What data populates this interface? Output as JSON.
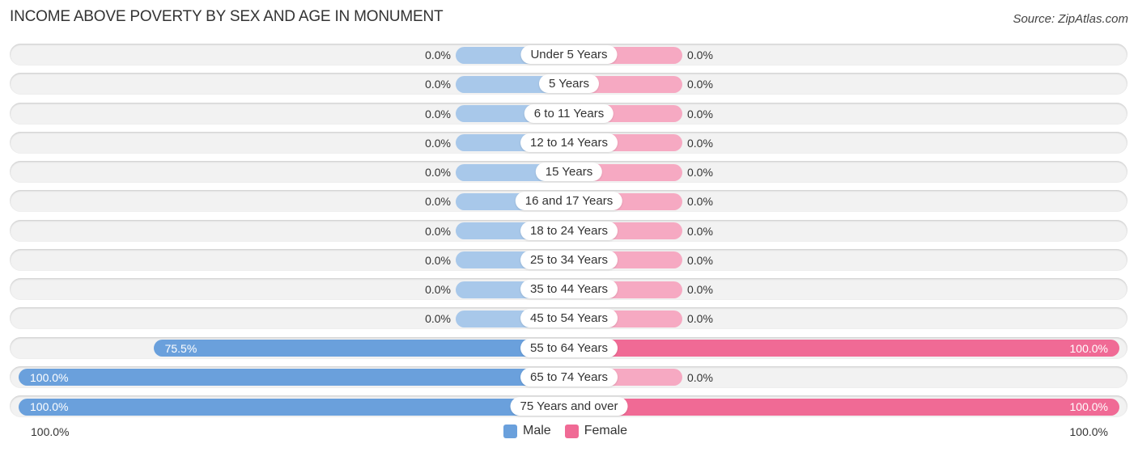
{
  "header": {
    "title": "INCOME ABOVE POVERTY BY SEX AND AGE IN MONUMENT",
    "source": "Source: ZipAtlas.com"
  },
  "colors": {
    "male": "#6aa0dc",
    "female": "#f06a95",
    "male_zero": "#a8c8ea",
    "female_zero": "#f6a9c2",
    "track": "#f2f2f2"
  },
  "chart_data": {
    "type": "bar",
    "orientation": "horizontal-diverging",
    "title": "INCOME ABOVE POVERTY BY SEX AND AGE IN MONUMENT",
    "categories": [
      "Under 5 Years",
      "5 Years",
      "6 to 11 Years",
      "12 to 14 Years",
      "15 Years",
      "16 and 17 Years",
      "18 to 24 Years",
      "25 to 34 Years",
      "35 to 44 Years",
      "45 to 54 Years",
      "55 to 64 Years",
      "65 to 74 Years",
      "75 Years and over"
    ],
    "series": [
      {
        "name": "Male",
        "values": [
          0.0,
          0.0,
          0.0,
          0.0,
          0.0,
          0.0,
          0.0,
          0.0,
          0.0,
          0.0,
          75.5,
          100.0,
          100.0
        ],
        "labels": [
          "0.0%",
          "0.0%",
          "0.0%",
          "0.0%",
          "0.0%",
          "0.0%",
          "0.0%",
          "0.0%",
          "0.0%",
          "0.0%",
          "75.5%",
          "100.0%",
          "100.0%"
        ]
      },
      {
        "name": "Female",
        "values": [
          0.0,
          0.0,
          0.0,
          0.0,
          0.0,
          0.0,
          0.0,
          0.0,
          0.0,
          0.0,
          100.0,
          0.0,
          100.0
        ],
        "labels": [
          "0.0%",
          "0.0%",
          "0.0%",
          "0.0%",
          "0.0%",
          "0.0%",
          "0.0%",
          "0.0%",
          "0.0%",
          "0.0%",
          "100.0%",
          "0.0%",
          "100.0%"
        ]
      }
    ],
    "xlim": [
      0,
      100
    ],
    "axis_labels": {
      "left": "100.0%",
      "right": "100.0%"
    },
    "legend": {
      "position": "bottom-center",
      "entries": [
        "Male",
        "Female"
      ]
    },
    "xlabel": "",
    "ylabel": ""
  }
}
